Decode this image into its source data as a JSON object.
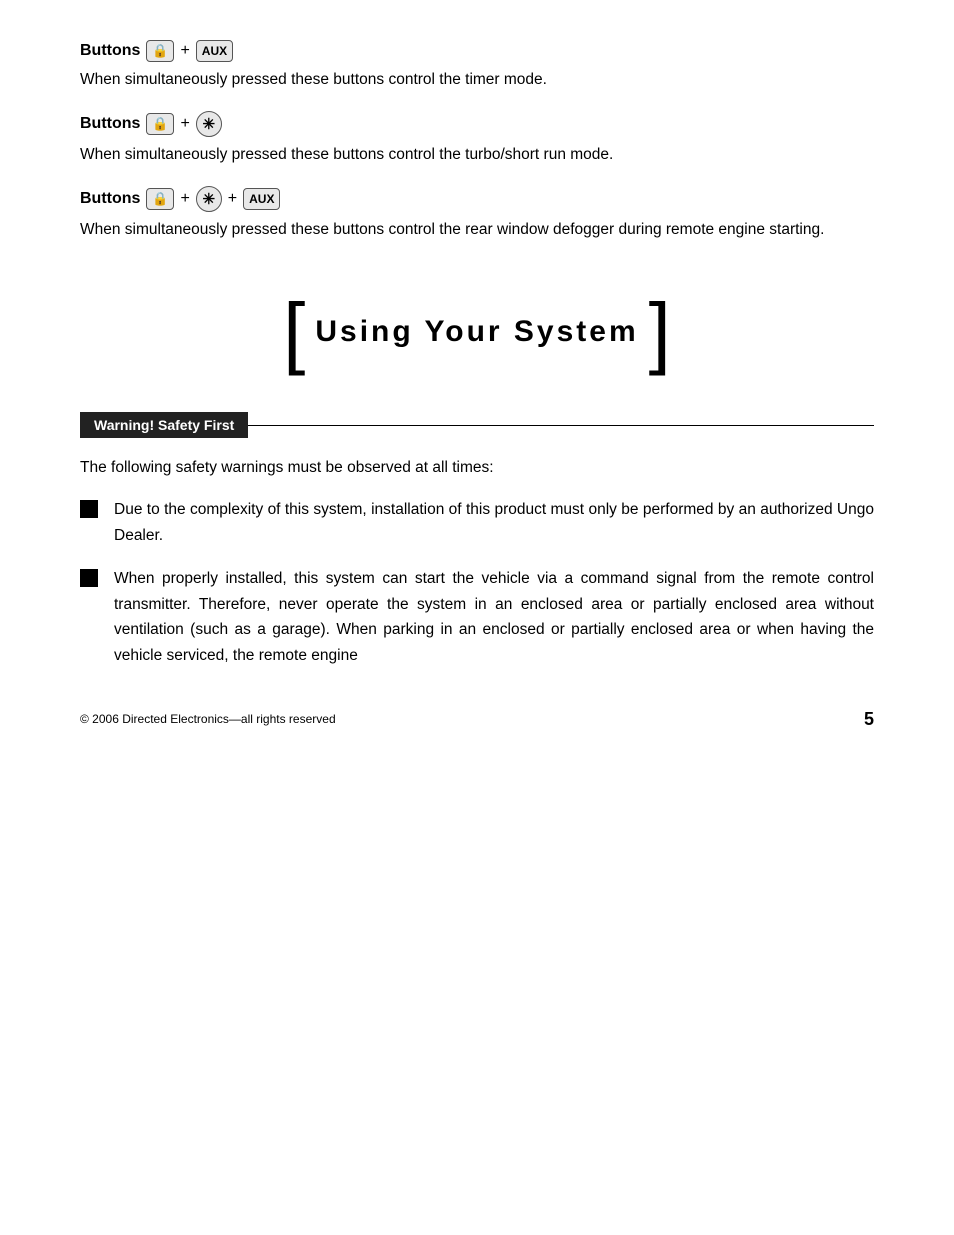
{
  "sections": [
    {
      "id": "buttons-aux",
      "label": "Buttons",
      "icon1": "lock-icon",
      "icon1_symbol": "🔒",
      "plus1": "+",
      "icon2": "aux-label",
      "icon2_text": "AUX",
      "description": "When simultaneously pressed these buttons control the timer mode."
    },
    {
      "id": "buttons-star",
      "label": "Buttons",
      "icon1": "lock-icon",
      "icon1_symbol": "🔒",
      "plus1": "+",
      "icon2": "star-icon",
      "icon2_text": "✳",
      "description": "When simultaneously pressed these buttons control the turbo/short run mode."
    },
    {
      "id": "buttons-star-aux",
      "label": "Buttons",
      "icon1": "lock-icon",
      "icon1_symbol": "🔒",
      "plus1": "+",
      "icon2": "star-icon",
      "icon2_text": "✳",
      "plus2": "+",
      "icon3": "aux-label",
      "icon3_text": "AUX",
      "description": "When simultaneously pressed these buttons control the rear window defogger during remote engine starting."
    }
  ],
  "section_heading": {
    "bracket_left": "[",
    "title": "Using Your System",
    "bracket_right": "]"
  },
  "warning": {
    "bar_text": "Warning! Safety First",
    "intro": "The following safety warnings must be observed at all times:",
    "bullets": [
      "Due to the complexity of this system, installation of this product must only be performed by an authorized Ungo Dealer.",
      "When properly installed, this system can start the vehicle via a command signal from the remote control transmitter. Therefore, never operate the system in an enclosed area or partially enclosed area without ventilation (such as a garage). When parking in an enclosed or partially enclosed area or when having the vehicle serviced, the remote engine"
    ]
  },
  "footer": {
    "copyright": "© 2006 Directed Electronics—all rights reserved",
    "page_number": "5"
  }
}
